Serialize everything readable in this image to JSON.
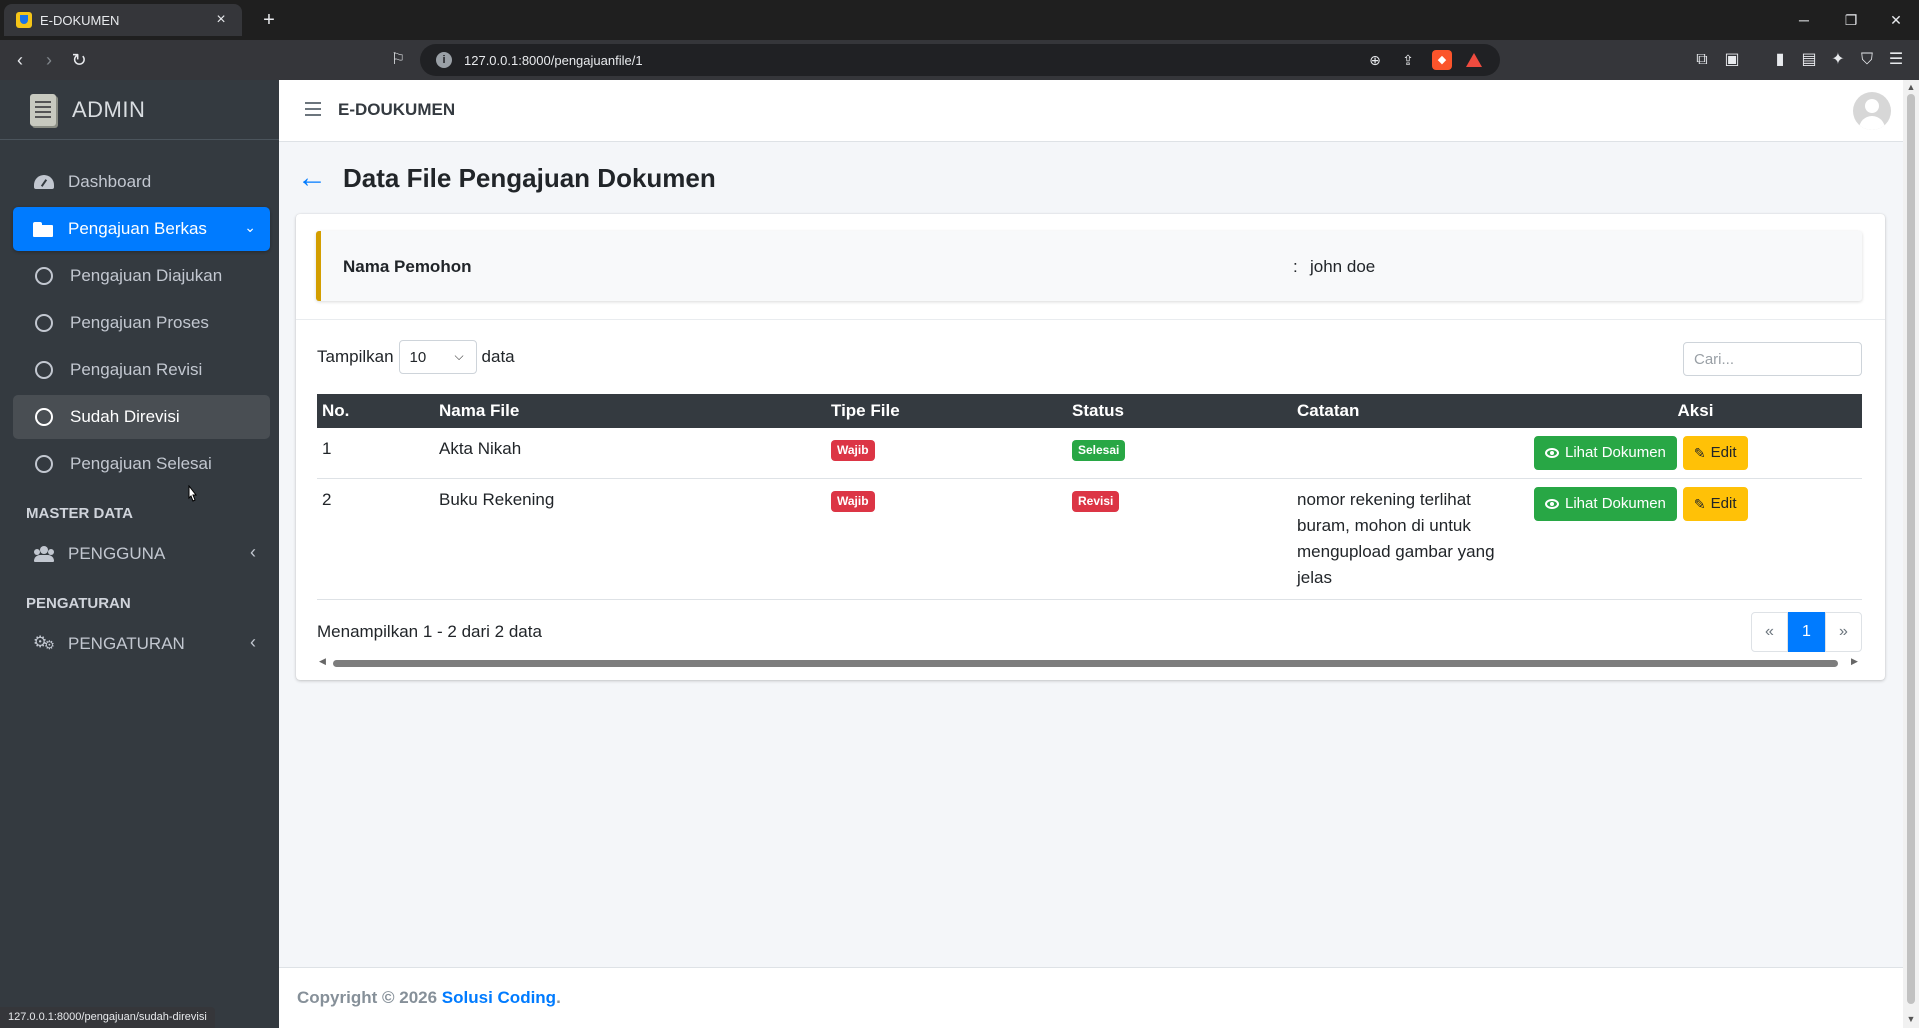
{
  "browser": {
    "tab_title": "E-DOKUMEN",
    "tab_close": "×",
    "new_tab": "+",
    "url": "127.0.0.1:8000/pengajuanfile/1",
    "status_url": "127.0.0.1:8000/pengajuan/sudah-direvisi"
  },
  "sidebar": {
    "brand": "ADMIN",
    "items": [
      {
        "label": "Dashboard",
        "icon": "dashboard-icon"
      },
      {
        "label": "Pengajuan Berkas",
        "icon": "folder-icon",
        "active": true
      },
      {
        "label": "Pengajuan Diajukan",
        "icon": "circle-icon"
      },
      {
        "label": "Pengajuan Proses",
        "icon": "circle-icon"
      },
      {
        "label": "Pengajuan Revisi",
        "icon": "circle-icon"
      },
      {
        "label": "Sudah Direvisi",
        "icon": "circle-icon",
        "hover": true
      },
      {
        "label": "Pengajuan Selesai",
        "icon": "circle-icon"
      }
    ],
    "header_master": "MASTER DATA",
    "pengguna": "PENGGUNA",
    "header_pengaturan": "PENGATURAN",
    "pengaturan": "PENGATURAN"
  },
  "topnav": {
    "title": "E-DOUKUMEN"
  },
  "page": {
    "title": "Data File Pengajuan Dokumen",
    "back_icon": "←"
  },
  "callout": {
    "label": "Nama Pemohon",
    "separator": ":",
    "value": "john doe"
  },
  "table_controls": {
    "length_prefix": "Tampilkan",
    "length_value": "10",
    "length_suffix": "data",
    "search_placeholder": "Cari..."
  },
  "table": {
    "columns": [
      "No.",
      "Nama File",
      "Tipe File",
      "Status",
      "Catatan",
      "Aksi"
    ],
    "rows": [
      {
        "no": "1",
        "nama_file": "Akta Nikah",
        "tipe_file": "Wajib",
        "status": "Selesai",
        "catatan": "",
        "view_label": "Lihat Dokumen",
        "edit_label": "Edit"
      },
      {
        "no": "2",
        "nama_file": "Buku Rekening",
        "tipe_file": "Wajib",
        "status": "Revisi",
        "catatan": "nomor rekening terlihat buram, mohon di untuk mengupload gambar yang jelas",
        "view_label": "Lihat Dokumen",
        "edit_label": "Edit"
      }
    ]
  },
  "pagination": {
    "info": "Menampilkan 1 - 2 dari 2 data",
    "prev": "«",
    "current": "1",
    "next": "»"
  },
  "footer": {
    "prefix": "Copyright © 2026",
    "link": "Solusi Coding",
    "suffix": "."
  },
  "colors": {
    "primary": "#007bff",
    "sidebar": "#343a40",
    "success": "#28a745",
    "danger": "#dc3545",
    "warning": "#ffc107",
    "callout_border": "#d39e00"
  }
}
